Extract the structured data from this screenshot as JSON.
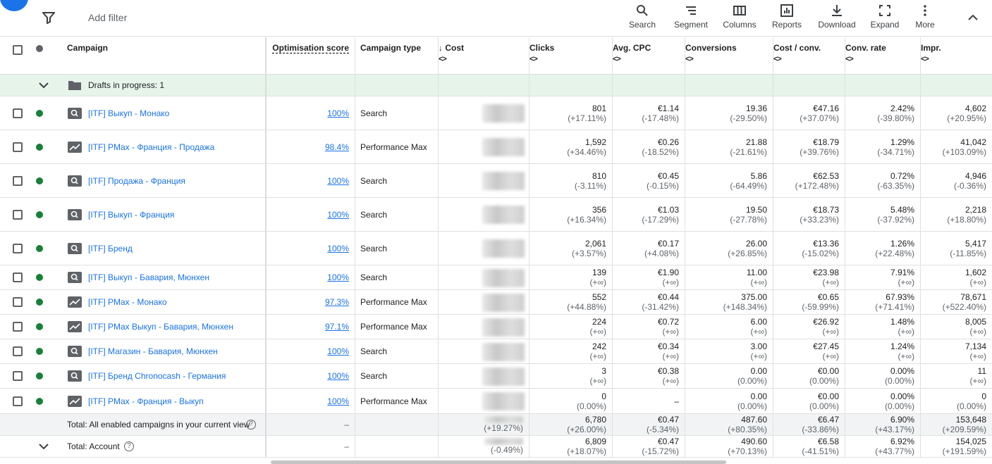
{
  "toolbar": {
    "add_filter": "Add filter",
    "buttons": [
      {
        "label": "Search",
        "icon": "search-icon"
      },
      {
        "label": "Segment",
        "icon": "segment-icon"
      },
      {
        "label": "Columns",
        "icon": "columns-icon"
      },
      {
        "label": "Reports",
        "icon": "reports-icon"
      },
      {
        "label": "Download",
        "icon": "download-icon"
      },
      {
        "label": "Expand",
        "icon": "expand-icon"
      },
      {
        "label": "More",
        "icon": "more-icon"
      }
    ]
  },
  "headers": {
    "campaign": "Campaign",
    "opt_score": "Optimisation score",
    "campaign_type": "Campaign type",
    "cost": "↓ Cost",
    "clicks": "Clicks",
    "avg_cpc": "Avg. CPC",
    "conversions": "Conversions",
    "cost_conv": "Cost / conv.",
    "conv_rate": "Conv. rate",
    "impr": "Impr.",
    "sort_glyph": "<>"
  },
  "drafts": {
    "label": "Drafts in progress: 1"
  },
  "rows": [
    {
      "name": "[ITF] Выкуп - Монако",
      "opt": "100%",
      "type": "Search",
      "icon": "search-campaign-icon",
      "clicks": "801",
      "clicks_d": "(+17.11%)",
      "cpc": "€1.14",
      "cpc_d": "(-17.48%)",
      "conv": "19.36",
      "conv_d": "(-29.50%)",
      "cpa": "€47.16",
      "cpa_d": "(+37.07%)",
      "rate": "2.42%",
      "rate_d": "(-39.80%)",
      "impr": "4,602",
      "impr_d": "(+20.95%)"
    },
    {
      "name": "[ITF] PMax - Франция - Продажа",
      "opt": "98.4%",
      "type": "Performance Max",
      "icon": "pmax-icon",
      "clicks": "1,592",
      "clicks_d": "(+34.46%)",
      "cpc": "€0.26",
      "cpc_d": "(-18.52%)",
      "conv": "21.88",
      "conv_d": "(-21.61%)",
      "cpa": "€18.79",
      "cpa_d": "(+39.76%)",
      "rate": "1.29%",
      "rate_d": "(-34.71%)",
      "impr": "41,042",
      "impr_d": "(+103.09%)"
    },
    {
      "name": "[ITF] Продажа - Франция",
      "opt": "100%",
      "type": "Search",
      "icon": "search-campaign-icon",
      "clicks": "810",
      "clicks_d": "(-3.11%)",
      "cpc": "€0.45",
      "cpc_d": "(-0.15%)",
      "conv": "5.86",
      "conv_d": "(-64.49%)",
      "cpa": "€62.53",
      "cpa_d": "(+172.48%)",
      "rate": "0.72%",
      "rate_d": "(-63.35%)",
      "impr": "4,946",
      "impr_d": "(-0.36%)"
    },
    {
      "name": "[ITF] Выкуп - Франция",
      "opt": "100%",
      "type": "Search",
      "icon": "search-campaign-icon",
      "clicks": "356",
      "clicks_d": "(+16.34%)",
      "cpc": "€1.03",
      "cpc_d": "(-17.29%)",
      "conv": "19.50",
      "conv_d": "(-27.78%)",
      "cpa": "€18.73",
      "cpa_d": "(+33.23%)",
      "rate": "5.48%",
      "rate_d": "(-37.92%)",
      "impr": "2,218",
      "impr_d": "(+18.80%)"
    },
    {
      "name": "[ITF] Бренд",
      "opt": "100%",
      "type": "Search",
      "icon": "search-campaign-icon",
      "clicks": "2,061",
      "clicks_d": "(+3.57%)",
      "cpc": "€0.17",
      "cpc_d": "(+4.08%)",
      "conv": "26.00",
      "conv_d": "(+26.85%)",
      "cpa": "€13.36",
      "cpa_d": "(-15.02%)",
      "rate": "1.26%",
      "rate_d": "(+22.48%)",
      "impr": "5,417",
      "impr_d": "(-11.85%)"
    },
    {
      "name": "[ITF] Выкуп - Бавария, Мюнхен",
      "opt": "100%",
      "type": "Search",
      "icon": "search-campaign-icon",
      "clicks": "139",
      "clicks_d": "(+∞)",
      "cpc": "€1.90",
      "cpc_d": "(+∞)",
      "conv": "11.00",
      "conv_d": "(+∞)",
      "cpa": "€23.98",
      "cpa_d": "(+∞)",
      "rate": "7.91%",
      "rate_d": "(+∞)",
      "impr": "1,602",
      "impr_d": "(+∞)"
    },
    {
      "name": "[ITF] PMax - Монако",
      "opt": "97.3%",
      "type": "Performance Max",
      "icon": "pmax-icon",
      "clicks": "552",
      "clicks_d": "(+44.88%)",
      "cpc": "€0.44",
      "cpc_d": "(-31.42%)",
      "conv": "375.00",
      "conv_d": "(+148.34%)",
      "cpa": "€0.65",
      "cpa_d": "(-59.99%)",
      "rate": "67.93%",
      "rate_d": "(+71.41%)",
      "impr": "78,671",
      "impr_d": "(+522.40%)"
    },
    {
      "name": "[ITF] PMax Выкуп - Бавария, Мюнхен",
      "opt": "97.1%",
      "type": "Performance Max",
      "icon": "pmax-icon",
      "clicks": "224",
      "clicks_d": "(+∞)",
      "cpc": "€0.72",
      "cpc_d": "(+∞)",
      "conv": "6.00",
      "conv_d": "(+∞)",
      "cpa": "€26.92",
      "cpa_d": "(+∞)",
      "rate": "1.48%",
      "rate_d": "(+∞)",
      "impr": "8,005",
      "impr_d": "(+∞)"
    },
    {
      "name": "[ITF] Магазин - Бавария, Мюнхен",
      "opt": "100%",
      "type": "Search",
      "icon": "search-campaign-icon",
      "clicks": "242",
      "clicks_d": "(+∞)",
      "cpc": "€0.34",
      "cpc_d": "(+∞)",
      "conv": "3.00",
      "conv_d": "(+∞)",
      "cpa": "€27.45",
      "cpa_d": "(+∞)",
      "rate": "1.24%",
      "rate_d": "(+∞)",
      "impr": "7,134",
      "impr_d": "(+∞)"
    },
    {
      "name": "[ITF] Бренд Chronocash - Германия",
      "opt": "100%",
      "type": "Search",
      "icon": "search-campaign-icon",
      "clicks": "3",
      "clicks_d": "(+∞)",
      "cpc": "€0.38",
      "cpc_d": "(+∞)",
      "conv": "0.00",
      "conv_d": "(0.00%)",
      "cpa": "€0.00",
      "cpa_d": "(0.00%)",
      "rate": "0.00%",
      "rate_d": "(0.00%)",
      "impr": "11",
      "impr_d": "(+∞)"
    },
    {
      "name": "[ITF] PMax - Франция - Выкуп",
      "opt": "100%",
      "type": "Performance Max",
      "icon": "pmax-icon",
      "clicks": "0",
      "clicks_d": "(0.00%)",
      "cpc": "–",
      "cpc_d": "",
      "conv": "0.00",
      "conv_d": "(0.00%)",
      "cpa": "€0.00",
      "cpa_d": "(0.00%)",
      "rate": "0.00%",
      "rate_d": "(0.00%)",
      "impr": "0",
      "impr_d": "(0.00%)"
    }
  ],
  "totals": [
    {
      "label": "Total: All enabled campaigns in your current view",
      "opt": "–",
      "cost_d": "(+19.27%)",
      "clicks": "6,780",
      "clicks_d": "(+26.00%)",
      "cpc": "€0.47",
      "cpc_d": "(-5.34%)",
      "conv": "487.60",
      "conv_d": "(+80.35%)",
      "cpa": "€6.47",
      "cpa_d": "(-33.86%)",
      "rate": "6.90%",
      "rate_d": "(+43.17%)",
      "impr": "153,648",
      "impr_d": "(+209.59%)"
    },
    {
      "label": "Total: Account",
      "opt": "–",
      "cost_d": "(-0.49%)",
      "clicks": "6,809",
      "clicks_d": "(+18.07%)",
      "cpc": "€0.47",
      "cpc_d": "(-15.72%)",
      "conv": "490.60",
      "conv_d": "(+70.13%)",
      "cpa": "€6.58",
      "cpa_d": "(-41.51%)",
      "rate": "6.92%",
      "rate_d": "(+43.77%)",
      "impr": "154,025",
      "impr_d": "(+191.59%)"
    }
  ]
}
